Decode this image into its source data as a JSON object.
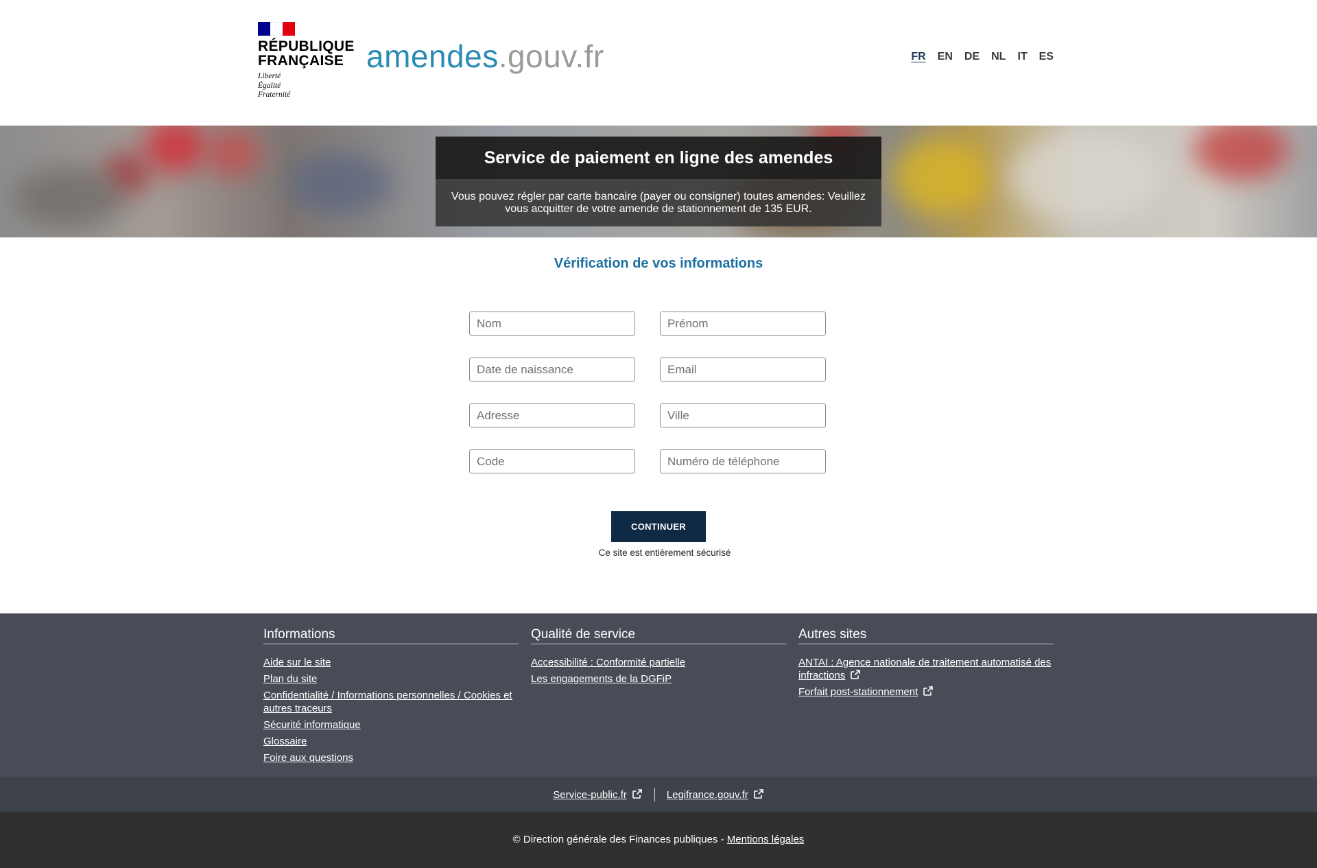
{
  "header": {
    "republic_name": "RÉPUBLIQUE\nFRANÇAISE",
    "motto": "Liberté\nÉgalité\nFraternité",
    "site_logo_part1": "amendes",
    "site_logo_part2": ".gouv.fr",
    "languages": [
      "FR",
      "EN",
      "DE",
      "NL",
      "IT",
      "ES"
    ],
    "active_language": "FR"
  },
  "hero": {
    "title": "Service de paiement en ligne des amendes",
    "description": "Vous pouvez régler par carte bancaire (payer ou consigner) toutes amendes: Veuillez vous acquitter de votre amende de stationnement de 135 EUR."
  },
  "form": {
    "title": "Vérification de vos informations",
    "fields": {
      "nom": {
        "placeholder": "Nom",
        "value": ""
      },
      "prenom": {
        "placeholder": "Prénom",
        "value": ""
      },
      "date_naissance": {
        "placeholder": "Date de naissance",
        "value": ""
      },
      "email": {
        "placeholder": "Email",
        "value": ""
      },
      "adresse": {
        "placeholder": "Adresse",
        "value": ""
      },
      "ville": {
        "placeholder": "Ville",
        "value": ""
      },
      "code": {
        "placeholder": "Code",
        "value": ""
      },
      "telephone": {
        "placeholder": "Numéro de téléphone",
        "value": ""
      }
    },
    "submit_label": "CONTINUER",
    "secure_note": "Ce site est entièrement sécurisé"
  },
  "footer": {
    "informations": {
      "title": "Informations",
      "links": [
        "Aide sur le site",
        "Plan du site",
        "Confidentialité / Informations personnelles / Cookies et autres traceurs",
        "Sécurité informatique",
        "Glossaire",
        "Foire aux questions"
      ]
    },
    "qualite": {
      "title": "Qualité de service",
      "links": [
        "Accessibilité : Conformité partielle",
        "Les engagements de la DGFiP"
      ]
    },
    "autres_sites": {
      "title": "Autres sites",
      "links": [
        "ANTAI : Agence nationale de traitement automatisé des infractions",
        "Forfait post-stationnement"
      ]
    },
    "bar_links": [
      "Service-public.fr",
      "Legifrance.gouv.fr"
    ],
    "copyright": "© Direction générale des Finances publiques - ",
    "legal_link": "Mentions légales"
  },
  "colors": {
    "brand_blue": "#2a8bb5",
    "title_blue": "#1b6fa0",
    "button_bg": "#0f2a44",
    "footer_bg": "#474c56",
    "footer_bar_bg": "#3e424b",
    "copyright_bg": "#303030"
  },
  "icons": {
    "external_link": "external-link-icon"
  }
}
